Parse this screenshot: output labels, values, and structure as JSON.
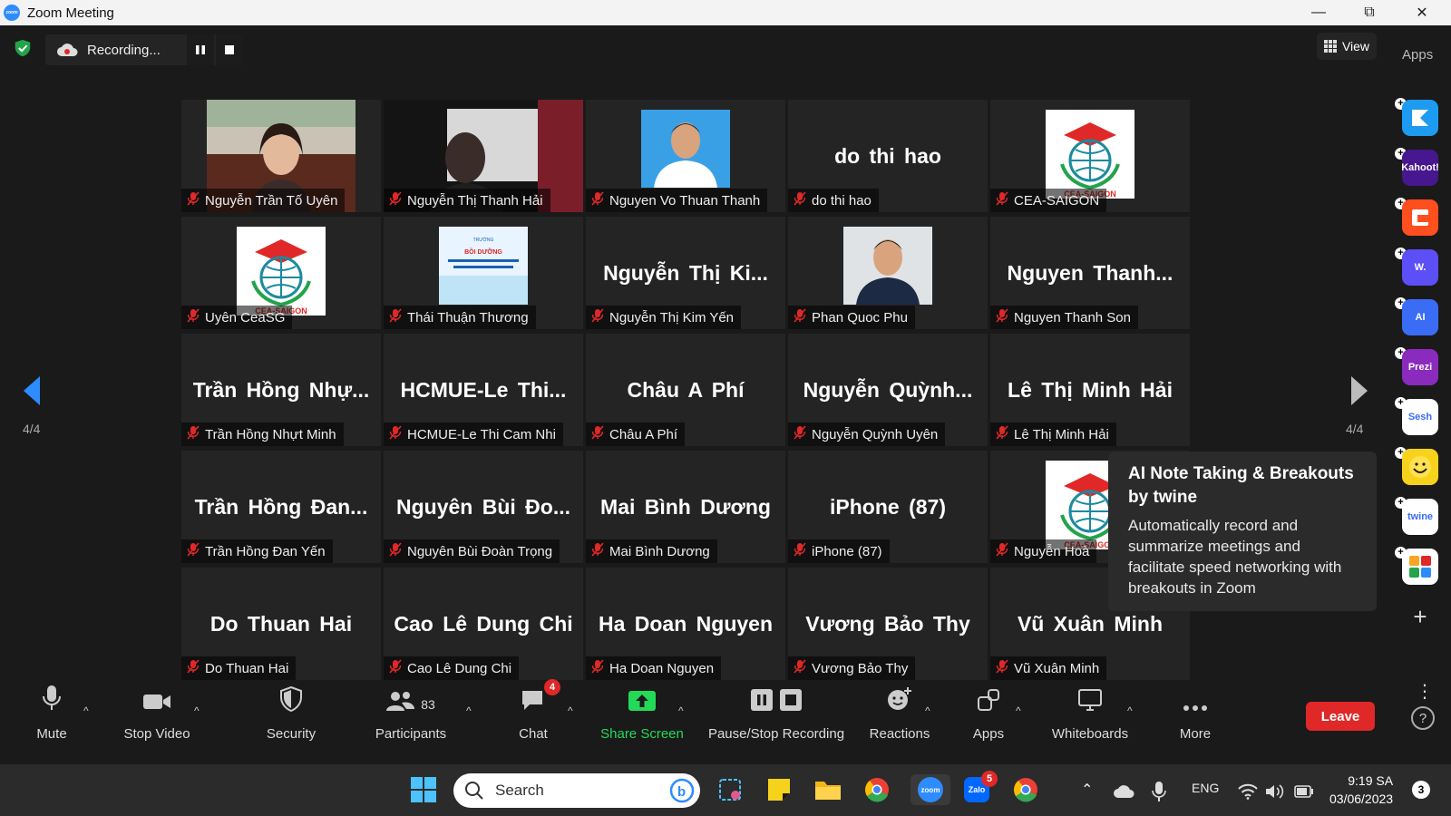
{
  "window": {
    "title": "Zoom Meeting",
    "app_logo": "zoom"
  },
  "topbar": {
    "recording_label": "Recording...",
    "view_label": "View",
    "apps_label": "Apps"
  },
  "colors": {
    "accent": "#2d8cff",
    "leave": "#e02828",
    "share": "#23d959",
    "muted": "#e02828"
  },
  "pagination": {
    "left_label": "4/4",
    "right_label": "4/4"
  },
  "tiles": [
    {
      "big": "",
      "name": "Nguyễn Trần Tố Uyên",
      "photo": "video"
    },
    {
      "big": "",
      "name": "Nguyễn Thị Thanh Hải",
      "photo": "video"
    },
    {
      "big": "",
      "name": "Nguyen Vo Thuan Thanh",
      "photo": "portrait"
    },
    {
      "big": "do thi hao",
      "name": "do thi hao",
      "photo": ""
    },
    {
      "big": "",
      "name": "CEA-SAIGON",
      "photo": "logo"
    },
    {
      "big": "",
      "name": "Uyên CeaSG",
      "photo": "logo"
    },
    {
      "big": "",
      "name": "Thái Thuận Thương",
      "photo": "document"
    },
    {
      "big": "Nguyễn Thị Ki...",
      "name": "Nguyễn Thị Kim Yến",
      "photo": ""
    },
    {
      "big": "",
      "name": "Phan Quoc Phu",
      "photo": "portrait2"
    },
    {
      "big": "Nguyen Thanh...",
      "name": "Nguyen Thanh Son",
      "photo": ""
    },
    {
      "big": "Trần Hồng Nhự...",
      "name": "Trần Hồng Nhựt Minh",
      "photo": ""
    },
    {
      "big": "HCMUE-Le Thi...",
      "name": "HCMUE-Le Thi Cam Nhi",
      "photo": ""
    },
    {
      "big": "Châu A Phí",
      "name": "Châu A Phí",
      "photo": ""
    },
    {
      "big": "Nguyễn Quỳnh...",
      "name": "Nguyễn Quỳnh Uyên",
      "photo": ""
    },
    {
      "big": "Lê Thị Minh Hải",
      "name": "Lê Thị Minh Hải",
      "photo": ""
    },
    {
      "big": "Trần Hồng Đan...",
      "name": "Trần Hồng Đan Yến",
      "photo": ""
    },
    {
      "big": "Nguyên Bùi Đo...",
      "name": "Nguyên Bùi Đoàn Trọng",
      "photo": ""
    },
    {
      "big": "Mai Bình Dương",
      "name": "Mai Bình Dương",
      "photo": ""
    },
    {
      "big": "iPhone (87)",
      "name": "iPhone (87)",
      "photo": ""
    },
    {
      "big": "",
      "name": "Nguyễn Hoà",
      "photo": "logo"
    },
    {
      "big": "Do Thuan Hai",
      "name": "Do Thuan Hai",
      "photo": ""
    },
    {
      "big": "Cao Lê Dung Chi",
      "name": "Cao Lê Dung Chi",
      "photo": ""
    },
    {
      "big": "Ha Doan Nguyen",
      "name": "Ha Doan Nguyen",
      "photo": ""
    },
    {
      "big": "Vương Bảo Thy",
      "name": "Vương Bảo Thy",
      "photo": ""
    },
    {
      "big": "Vũ Xuân Minh",
      "name": "Vũ Xuân Minh",
      "photo": ""
    }
  ],
  "tile_logo_text": "CEA-SAIGON",
  "tooltip": {
    "title": "AI Note Taking & Breakouts by twine",
    "description": "Automatically record and summarize meetings and facilitate speed networking with breakouts in Zoom"
  },
  "sidebar_apps": [
    {
      "icon": "arrow-app-icon",
      "text": "",
      "color": "#1d9bf0"
    },
    {
      "icon": "kahoot-icon",
      "text": "Kahoot!",
      "color": "#46178f"
    },
    {
      "icon": "square-app-icon",
      "text": "",
      "color": "#ff4f1f"
    },
    {
      "icon": "w-app-icon",
      "text": "W.",
      "color": "#5b4ff5"
    },
    {
      "icon": "ai-app-icon",
      "text": "AI",
      "color": "#3a6cf5"
    },
    {
      "icon": "prezi-icon",
      "text": "Prezi",
      "color": "#8a2bbd"
    },
    {
      "icon": "sesh-icon",
      "text": "Sesh",
      "color": "#ffffff"
    },
    {
      "icon": "emoji-app-icon",
      "text": "",
      "color": "#f7d21c"
    },
    {
      "icon": "twine-icon",
      "text": "twine",
      "color": "#ffffff"
    },
    {
      "icon": "blocks-app-icon",
      "text": "",
      "color": "#ffffff"
    }
  ],
  "toolbar": {
    "mute": "Mute",
    "stop_video": "Stop Video",
    "security": "Security",
    "participants": "Participants",
    "participants_count": "83",
    "chat": "Chat",
    "chat_badge": "4",
    "share_screen": "Share Screen",
    "pause_stop_recording": "Pause/Stop Recording",
    "reactions": "Reactions",
    "apps": "Apps",
    "whiteboards": "Whiteboards",
    "more": "More",
    "leave": "Leave"
  },
  "taskbar": {
    "search_placeholder": "Search",
    "zalo_badge": "5",
    "language": "ENG",
    "time": "9:19 SA",
    "date": "03/06/2023",
    "notification_count": "3"
  }
}
